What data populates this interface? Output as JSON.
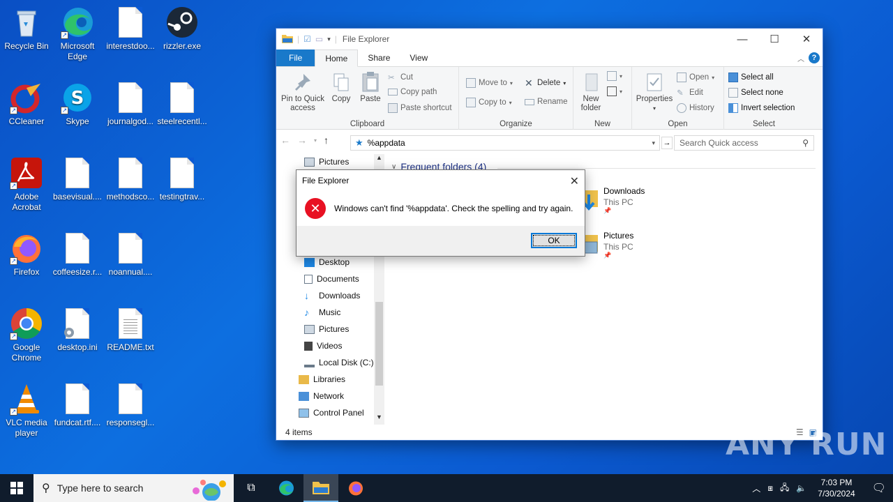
{
  "desktop": {
    "icons": [
      {
        "label": "Recycle Bin"
      },
      {
        "label": "Microsoft Edge"
      },
      {
        "label": "interestdoo..."
      },
      {
        "label": "rizzler.exe"
      },
      {
        "label": "CCleaner"
      },
      {
        "label": "Skype"
      },
      {
        "label": "journalgod..."
      },
      {
        "label": "steelrecentl..."
      },
      {
        "label": "Adobe Acrobat"
      },
      {
        "label": "basevisual...."
      },
      {
        "label": "methodsco..."
      },
      {
        "label": "testingtrav..."
      },
      {
        "label": "Firefox"
      },
      {
        "label": "coffeesize.r..."
      },
      {
        "label": "noannual...."
      },
      {
        "label": "Google Chrome"
      },
      {
        "label": "desktop.ini"
      },
      {
        "label": "README.txt"
      },
      {
        "label": "VLC media player"
      },
      {
        "label": "fundcat.rtf...."
      },
      {
        "label": "responsegl..."
      }
    ]
  },
  "explorer": {
    "title": "File Explorer",
    "tabs": {
      "file": "File",
      "home": "Home",
      "share": "Share",
      "view": "View"
    },
    "ribbon": {
      "clipboard": {
        "pin_line1": "Pin to Quick",
        "pin_line2": "access",
        "copy": "Copy",
        "paste": "Paste",
        "cut": "Cut",
        "copy_path": "Copy path",
        "paste_shortcut": "Paste shortcut",
        "label": "Clipboard"
      },
      "organize": {
        "move_to": "Move to",
        "copy_to": "Copy to",
        "delete": "Delete",
        "rename": "Rename",
        "label": "Organize"
      },
      "new": {
        "new_line1": "New",
        "new_line2": "folder",
        "label": "New"
      },
      "open": {
        "properties": "Properties",
        "open": "Open",
        "edit": "Edit",
        "history": "History",
        "label": "Open"
      },
      "select": {
        "select_all": "Select all",
        "select_none": "Select none",
        "invert": "Invert selection",
        "label": "Select"
      }
    },
    "address": "%appdata",
    "search_placeholder": "Search Quick access",
    "nav": {
      "items": [
        {
          "label": "Pictures"
        },
        {
          "label": "Desktop"
        },
        {
          "label": "Documents"
        },
        {
          "label": "Downloads"
        },
        {
          "label": "Music"
        },
        {
          "label": "Pictures"
        },
        {
          "label": "Videos"
        },
        {
          "label": "Local Disk (C:)"
        },
        {
          "label": "Libraries"
        },
        {
          "label": "Network"
        },
        {
          "label": "Control Panel"
        }
      ]
    },
    "content": {
      "section": "Frequent folders (4)",
      "folders": [
        {
          "name": "Downloads",
          "location": "This PC"
        },
        {
          "name": "Pictures",
          "location": "This PC"
        }
      ]
    },
    "status": "4 items"
  },
  "dialog": {
    "title": "File Explorer",
    "message": "Windows can't find '%appdata'. Check the spelling and try again.",
    "ok": "OK"
  },
  "taskbar": {
    "search_placeholder": "Type here to search",
    "time": "7:03 PM",
    "date": "7/30/2024"
  },
  "watermark": "ANY RUN",
  "colors": {
    "accent": "#1979ca",
    "error": "#e81123",
    "taskbar": "#101c2c"
  }
}
